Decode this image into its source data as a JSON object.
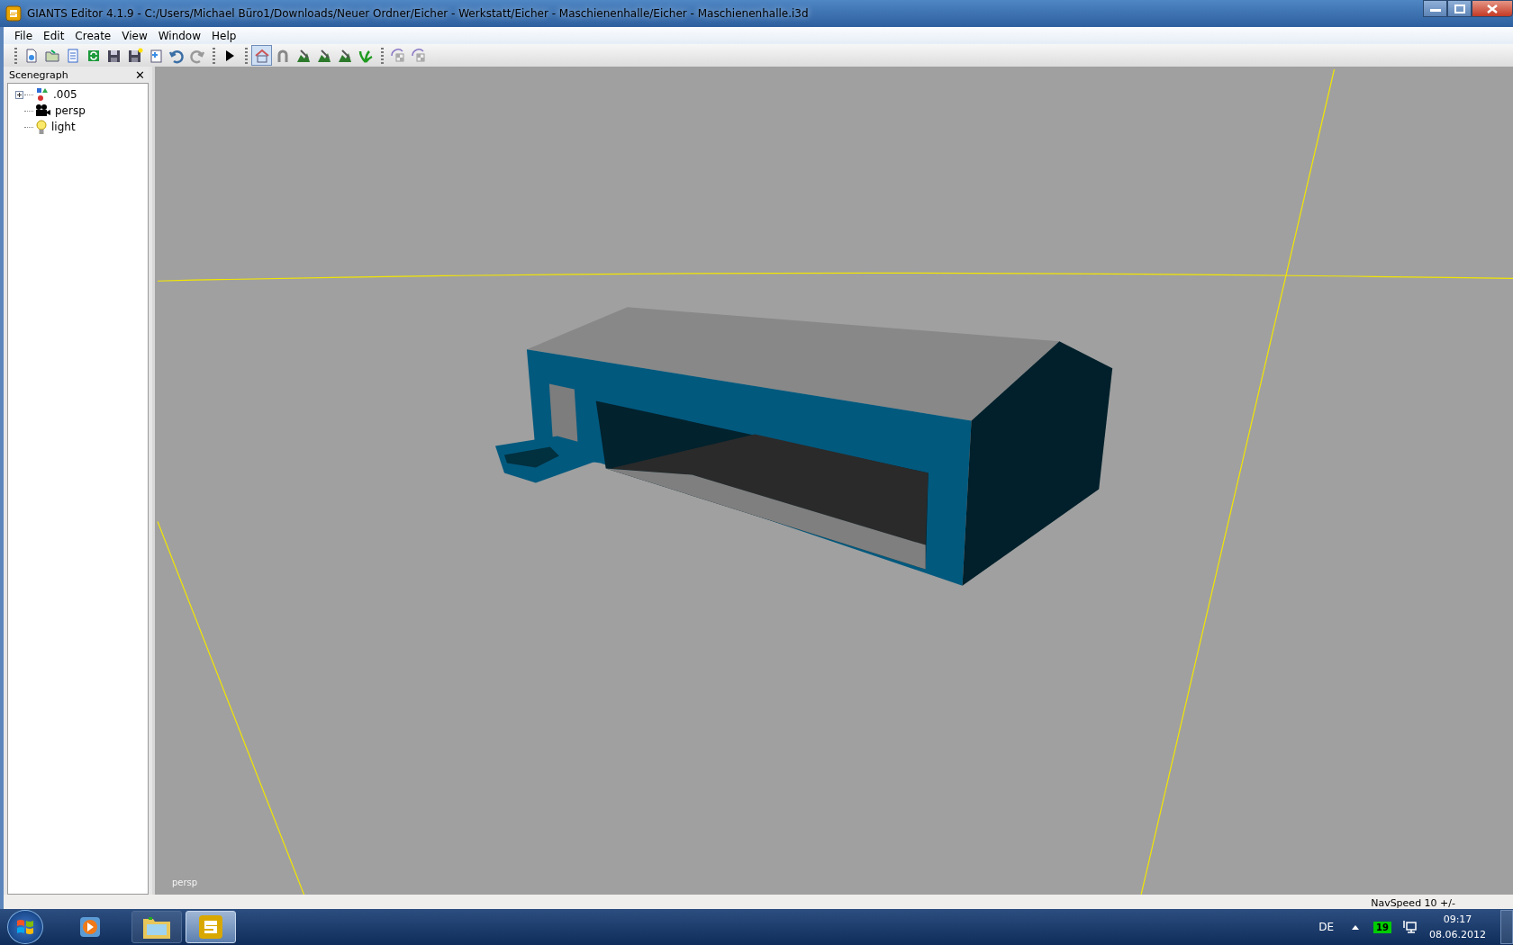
{
  "window": {
    "title": "GIANTS Editor 4.1.9 - C:/Users/Michael Büro1/Downloads/Neuer Ordner/Eicher - Werkstatt/Eicher - Maschienenhalle/Eicher - Maschienenhalle.i3d"
  },
  "menu": [
    "File",
    "Edit",
    "Create",
    "View",
    "Window",
    "Help"
  ],
  "toolbar": [
    {
      "icons": [
        {
          "selected": false
        },
        {
          "selected": false
        },
        {
          "selected": false
        },
        {
          "selected": false
        },
        {
          "selected": false
        },
        {
          "selected": false
        },
        {
          "selected": false
        },
        {
          "selected": false
        },
        {
          "selected": false
        }
      ]
    },
    {
      "icons": [
        {
          "selected": false
        }
      ]
    },
    {
      "icons": [
        {
          "selected": true
        },
        {
          "selected": false
        },
        {
          "selected": false
        },
        {
          "selected": false
        },
        {
          "selected": false
        },
        {
          "selected": false
        }
      ]
    },
    {
      "icons": [
        {
          "selected": false
        },
        {
          "selected": false
        }
      ]
    }
  ],
  "scenegraph": {
    "title": "Scenegraph",
    "close": "✕",
    "items": [
      {
        "label": ".005",
        "kind": "group",
        "expanded": false
      },
      {
        "label": "persp",
        "kind": "camera"
      },
      {
        "label": "light",
        "kind": "light"
      }
    ]
  },
  "viewport": {
    "camera_label": "persp"
  },
  "status_bar": {
    "nav_speed": "NavSpeed 10 +/-"
  },
  "taskbar": {
    "apps": [
      {
        "kind": "media",
        "selected": false
      },
      {
        "kind": "explorer",
        "selected": false
      },
      {
        "kind": "giants",
        "selected": true
      }
    ],
    "tray": {
      "language": "DE",
      "badge": "19",
      "time": "09:17",
      "date": "08.06.2012"
    }
  }
}
